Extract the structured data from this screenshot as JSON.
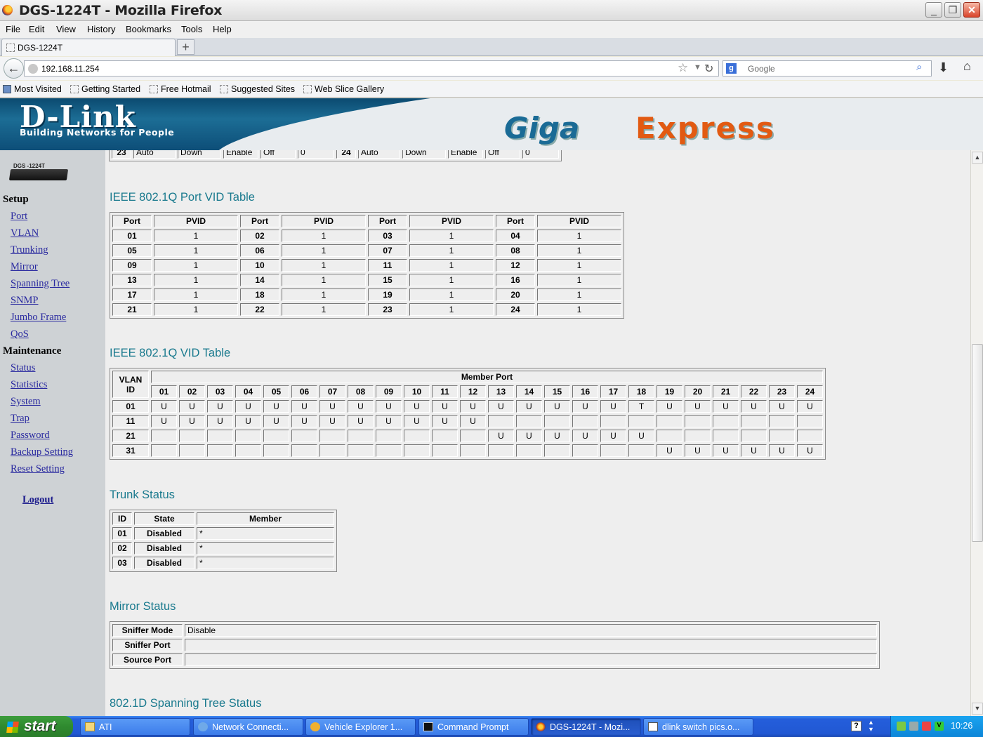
{
  "window": {
    "title": "DGS-1224T - Mozilla Firefox"
  },
  "menu": [
    "File",
    "Edit",
    "View",
    "History",
    "Bookmarks",
    "Tools",
    "Help"
  ],
  "tab": {
    "title": "DGS-1224T"
  },
  "nav": {
    "url": "192.168.11.254",
    "search_placeholder": "Google"
  },
  "bookmarks": [
    "Most Visited",
    "Getting Started",
    "Free Hotmail",
    "Suggested Sites",
    "Web Slice Gallery"
  ],
  "banner": {
    "logo": "D-Link",
    "tagline": "Building Networks for People",
    "product_a": "Giga",
    "product_b": "Express"
  },
  "sidebar": {
    "device_label": "DGS -1224T",
    "setup_heading": "Setup",
    "setup_links": [
      "Port",
      "VLAN",
      "Trunking",
      "Mirror",
      "Spanning Tree",
      "SNMP",
      "Jumbo Frame",
      "QoS"
    ],
    "maintenance_heading": "Maintenance",
    "maintenance_links": [
      "Status",
      "Statistics",
      "System",
      "Trap",
      "Password",
      "Backup Setting",
      "Reset Setting"
    ],
    "logout": "Logout"
  },
  "port_status_partial_row": [
    "23",
    "Auto",
    "Down",
    "Enable",
    "Off",
    "0",
    "24",
    "Auto",
    "Down",
    "Enable",
    "Off",
    "0"
  ],
  "pvid_table": {
    "title": "IEEE 802.1Q Port VID Table",
    "headers": [
      "Port",
      "PVID",
      "Port",
      "PVID",
      "Port",
      "PVID",
      "Port",
      "PVID"
    ],
    "rows": [
      [
        "01",
        "1",
        "02",
        "1",
        "03",
        "1",
        "04",
        "1"
      ],
      [
        "05",
        "1",
        "06",
        "1",
        "07",
        "1",
        "08",
        "1"
      ],
      [
        "09",
        "1",
        "10",
        "1",
        "11",
        "1",
        "12",
        "1"
      ],
      [
        "13",
        "1",
        "14",
        "1",
        "15",
        "1",
        "16",
        "1"
      ],
      [
        "17",
        "1",
        "18",
        "1",
        "19",
        "1",
        "20",
        "1"
      ],
      [
        "21",
        "1",
        "22",
        "1",
        "23",
        "1",
        "24",
        "1"
      ]
    ]
  },
  "vid_table": {
    "title": "IEEE 802.1Q VID Table",
    "vlan_header": "VLAN ID",
    "member_header": "Member Port",
    "ports": [
      "01",
      "02",
      "03",
      "04",
      "05",
      "06",
      "07",
      "08",
      "09",
      "10",
      "11",
      "12",
      "13",
      "14",
      "15",
      "16",
      "17",
      "18",
      "19",
      "20",
      "21",
      "22",
      "23",
      "24"
    ],
    "rows": [
      {
        "vlan": "01",
        "cells": [
          "U",
          "U",
          "U",
          "U",
          "U",
          "U",
          "U",
          "U",
          "U",
          "U",
          "U",
          "U",
          "U",
          "U",
          "U",
          "U",
          "U",
          "T",
          "U",
          "U",
          "U",
          "U",
          "U",
          "U"
        ]
      },
      {
        "vlan": "11",
        "cells": [
          "U",
          "U",
          "U",
          "U",
          "U",
          "U",
          "U",
          "U",
          "U",
          "U",
          "U",
          "U",
          "",
          "",
          "",
          "",
          "",
          "",
          "",
          "",
          "",
          "",
          "",
          ""
        ]
      },
      {
        "vlan": "21",
        "cells": [
          "",
          "",
          "",
          "",
          "",
          "",
          "",
          "",
          "",
          "",
          "",
          "",
          "U",
          "U",
          "U",
          "U",
          "U",
          "U",
          "",
          "",
          "",
          "",
          "",
          ""
        ]
      },
      {
        "vlan": "31",
        "cells": [
          "",
          "",
          "",
          "",
          "",
          "",
          "",
          "",
          "",
          "",
          "",
          "",
          "",
          "",
          "",
          "",
          "",
          "",
          "U",
          "U",
          "U",
          "U",
          "U",
          "U"
        ]
      }
    ]
  },
  "trunk_table": {
    "title": "Trunk Status",
    "headers": [
      "ID",
      "State",
      "Member"
    ],
    "rows": [
      [
        "01",
        "Disabled",
        "*"
      ],
      [
        "02",
        "Disabled",
        "*"
      ],
      [
        "03",
        "Disabled",
        "*"
      ]
    ]
  },
  "mirror_table": {
    "title": "Mirror Status",
    "rows": [
      [
        "Sniffer Mode",
        "Disable"
      ],
      [
        "Sniffer Port",
        ""
      ],
      [
        "Source Port",
        ""
      ]
    ]
  },
  "stp_title": "802.1D Spanning Tree Status",
  "taskbar": {
    "start": "start",
    "tasks": [
      "ATI",
      "Network Connecti...",
      "Vehicle Explorer 1...",
      "Command Prompt",
      "DGS-1224T - Mozi...",
      "dlink switch pics.o..."
    ],
    "clock": "10:26"
  }
}
